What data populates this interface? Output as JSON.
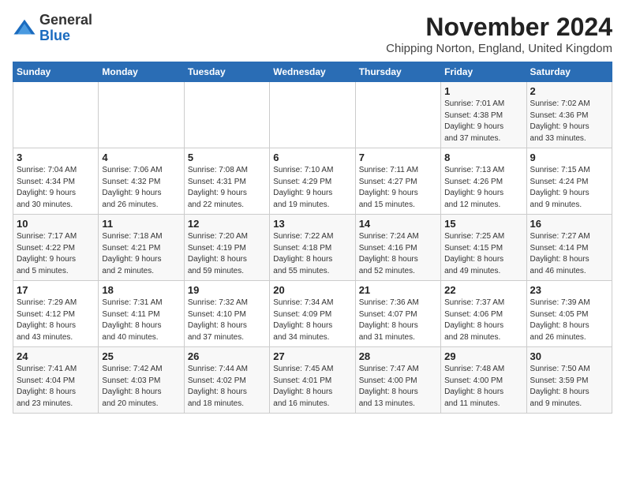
{
  "app": {
    "name_general": "General",
    "name_blue": "Blue"
  },
  "header": {
    "month": "November 2024",
    "location": "Chipping Norton, England, United Kingdom"
  },
  "weekdays": [
    "Sunday",
    "Monday",
    "Tuesday",
    "Wednesday",
    "Thursday",
    "Friday",
    "Saturday"
  ],
  "weeks": [
    [
      {
        "day": "",
        "info": ""
      },
      {
        "day": "",
        "info": ""
      },
      {
        "day": "",
        "info": ""
      },
      {
        "day": "",
        "info": ""
      },
      {
        "day": "",
        "info": ""
      },
      {
        "day": "1",
        "info": "Sunrise: 7:01 AM\nSunset: 4:38 PM\nDaylight: 9 hours\nand 37 minutes."
      },
      {
        "day": "2",
        "info": "Sunrise: 7:02 AM\nSunset: 4:36 PM\nDaylight: 9 hours\nand 33 minutes."
      }
    ],
    [
      {
        "day": "3",
        "info": "Sunrise: 7:04 AM\nSunset: 4:34 PM\nDaylight: 9 hours\nand 30 minutes."
      },
      {
        "day": "4",
        "info": "Sunrise: 7:06 AM\nSunset: 4:32 PM\nDaylight: 9 hours\nand 26 minutes."
      },
      {
        "day": "5",
        "info": "Sunrise: 7:08 AM\nSunset: 4:31 PM\nDaylight: 9 hours\nand 22 minutes."
      },
      {
        "day": "6",
        "info": "Sunrise: 7:10 AM\nSunset: 4:29 PM\nDaylight: 9 hours\nand 19 minutes."
      },
      {
        "day": "7",
        "info": "Sunrise: 7:11 AM\nSunset: 4:27 PM\nDaylight: 9 hours\nand 15 minutes."
      },
      {
        "day": "8",
        "info": "Sunrise: 7:13 AM\nSunset: 4:26 PM\nDaylight: 9 hours\nand 12 minutes."
      },
      {
        "day": "9",
        "info": "Sunrise: 7:15 AM\nSunset: 4:24 PM\nDaylight: 9 hours\nand 9 minutes."
      }
    ],
    [
      {
        "day": "10",
        "info": "Sunrise: 7:17 AM\nSunset: 4:22 PM\nDaylight: 9 hours\nand 5 minutes."
      },
      {
        "day": "11",
        "info": "Sunrise: 7:18 AM\nSunset: 4:21 PM\nDaylight: 9 hours\nand 2 minutes."
      },
      {
        "day": "12",
        "info": "Sunrise: 7:20 AM\nSunset: 4:19 PM\nDaylight: 8 hours\nand 59 minutes."
      },
      {
        "day": "13",
        "info": "Sunrise: 7:22 AM\nSunset: 4:18 PM\nDaylight: 8 hours\nand 55 minutes."
      },
      {
        "day": "14",
        "info": "Sunrise: 7:24 AM\nSunset: 4:16 PM\nDaylight: 8 hours\nand 52 minutes."
      },
      {
        "day": "15",
        "info": "Sunrise: 7:25 AM\nSunset: 4:15 PM\nDaylight: 8 hours\nand 49 minutes."
      },
      {
        "day": "16",
        "info": "Sunrise: 7:27 AM\nSunset: 4:14 PM\nDaylight: 8 hours\nand 46 minutes."
      }
    ],
    [
      {
        "day": "17",
        "info": "Sunrise: 7:29 AM\nSunset: 4:12 PM\nDaylight: 8 hours\nand 43 minutes."
      },
      {
        "day": "18",
        "info": "Sunrise: 7:31 AM\nSunset: 4:11 PM\nDaylight: 8 hours\nand 40 minutes."
      },
      {
        "day": "19",
        "info": "Sunrise: 7:32 AM\nSunset: 4:10 PM\nDaylight: 8 hours\nand 37 minutes."
      },
      {
        "day": "20",
        "info": "Sunrise: 7:34 AM\nSunset: 4:09 PM\nDaylight: 8 hours\nand 34 minutes."
      },
      {
        "day": "21",
        "info": "Sunrise: 7:36 AM\nSunset: 4:07 PM\nDaylight: 8 hours\nand 31 minutes."
      },
      {
        "day": "22",
        "info": "Sunrise: 7:37 AM\nSunset: 4:06 PM\nDaylight: 8 hours\nand 28 minutes."
      },
      {
        "day": "23",
        "info": "Sunrise: 7:39 AM\nSunset: 4:05 PM\nDaylight: 8 hours\nand 26 minutes."
      }
    ],
    [
      {
        "day": "24",
        "info": "Sunrise: 7:41 AM\nSunset: 4:04 PM\nDaylight: 8 hours\nand 23 minutes."
      },
      {
        "day": "25",
        "info": "Sunrise: 7:42 AM\nSunset: 4:03 PM\nDaylight: 8 hours\nand 20 minutes."
      },
      {
        "day": "26",
        "info": "Sunrise: 7:44 AM\nSunset: 4:02 PM\nDaylight: 8 hours\nand 18 minutes."
      },
      {
        "day": "27",
        "info": "Sunrise: 7:45 AM\nSunset: 4:01 PM\nDaylight: 8 hours\nand 16 minutes."
      },
      {
        "day": "28",
        "info": "Sunrise: 7:47 AM\nSunset: 4:00 PM\nDaylight: 8 hours\nand 13 minutes."
      },
      {
        "day": "29",
        "info": "Sunrise: 7:48 AM\nSunset: 4:00 PM\nDaylight: 8 hours\nand 11 minutes."
      },
      {
        "day": "30",
        "info": "Sunrise: 7:50 AM\nSunset: 3:59 PM\nDaylight: 8 hours\nand 9 minutes."
      }
    ]
  ]
}
